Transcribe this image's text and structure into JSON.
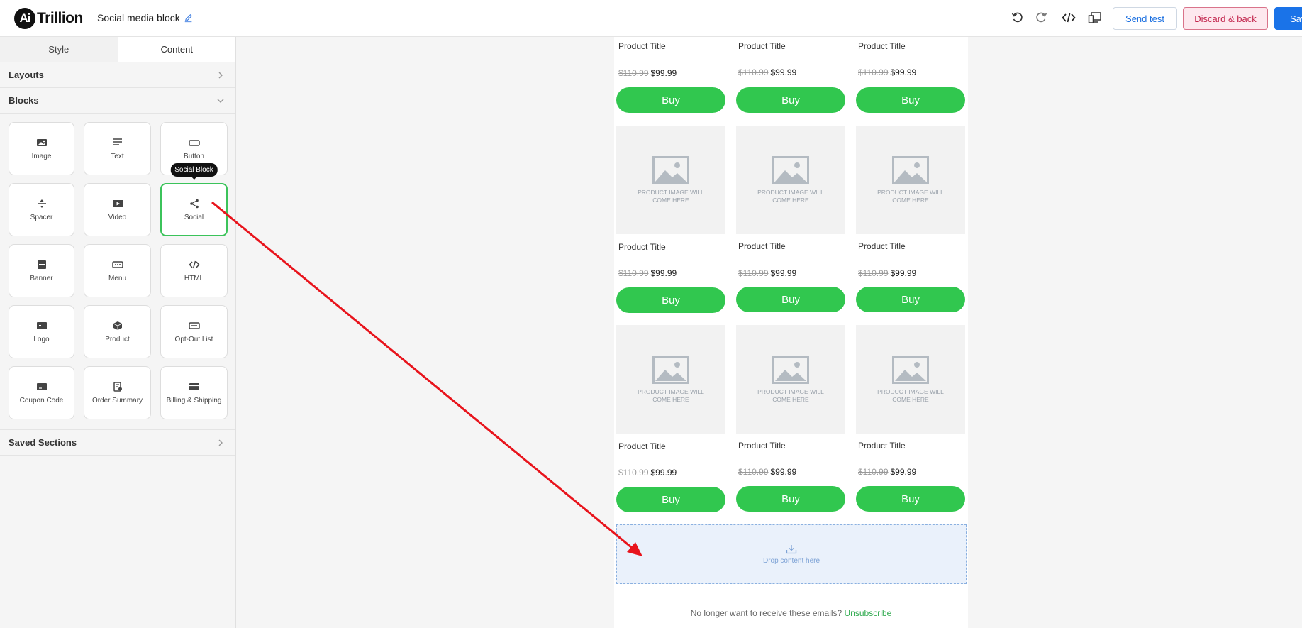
{
  "header": {
    "logo_mark": "Ai",
    "logo_text": "Trillion",
    "doc_title": "Social media block",
    "send_test": "Send test",
    "discard": "Discard & back",
    "save": "Save"
  },
  "sidebar": {
    "tabs": [
      "Style",
      "Content"
    ],
    "active_tab": "Content",
    "layouts_label": "Layouts",
    "blocks_label": "Blocks",
    "saved_sections_label": "Saved Sections",
    "tooltip": "Social Block",
    "blocks": [
      {
        "label": "Image",
        "icon": "image-icon"
      },
      {
        "label": "Text",
        "icon": "text-icon"
      },
      {
        "label": "Button",
        "icon": "button-icon"
      },
      {
        "label": "Spacer",
        "icon": "spacer-icon"
      },
      {
        "label": "Video",
        "icon": "video-icon"
      },
      {
        "label": "Social",
        "icon": "share-icon"
      },
      {
        "label": "Banner",
        "icon": "banner-icon"
      },
      {
        "label": "Menu",
        "icon": "menu-icon"
      },
      {
        "label": "HTML",
        "icon": "code-icon"
      },
      {
        "label": "Logo",
        "icon": "logo-icon"
      },
      {
        "label": "Product",
        "icon": "product-icon"
      },
      {
        "label": "Opt-Out List",
        "icon": "optout-icon"
      },
      {
        "label": "Coupon Code",
        "icon": "coupon-icon"
      },
      {
        "label": "Order Summary",
        "icon": "order-icon"
      },
      {
        "label": "Billing & Shipping",
        "icon": "billing-icon"
      }
    ]
  },
  "canvas": {
    "product_title": "Product Title",
    "old_price": "$110.99",
    "new_price": "$99.99",
    "buy_label": "Buy",
    "image_placeholder": "PRODUCT IMAGE WILL COME HERE",
    "drop_label": "Drop content here",
    "footer_text": "No longer want to receive these emails?",
    "unsubscribe": "Unsubscribe"
  },
  "colors": {
    "buy_green": "#31c74f",
    "annotation_arrow": "#e8141c",
    "save_blue": "#1a73e8"
  }
}
